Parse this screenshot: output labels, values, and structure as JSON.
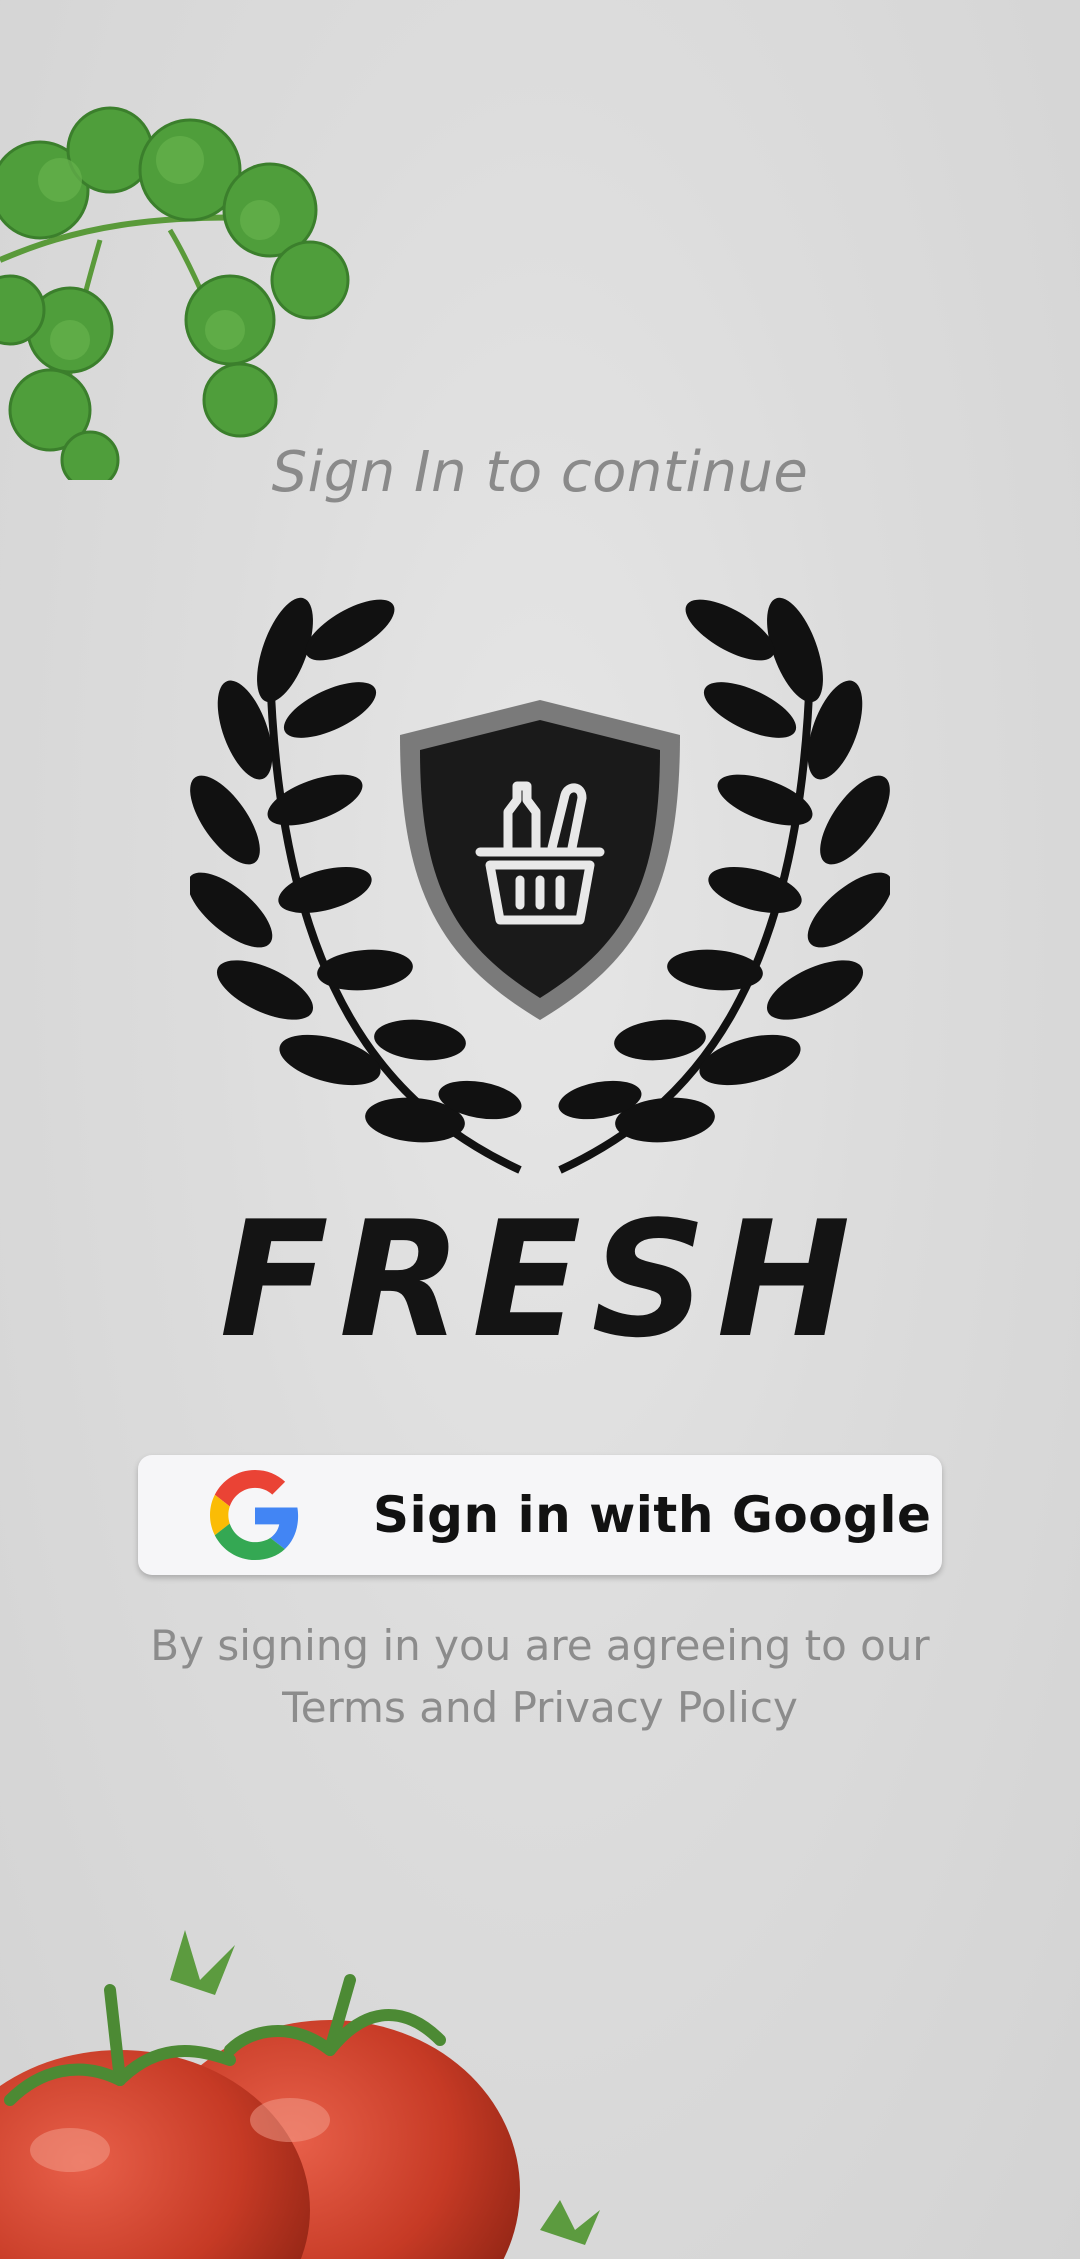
{
  "signin": {
    "title": "Sign In to continue"
  },
  "brand": {
    "name": "FRESH",
    "logo_icon": "shopping-basket-shield-laurel"
  },
  "google_button": {
    "label": "Sign in with Google",
    "icon": "google-g-icon"
  },
  "terms": {
    "line1": "By signing in you are agreeing to our",
    "line2": "Terms and Privacy Policy"
  },
  "decorations": {
    "top_left": "cilantro-herb",
    "bottom_left": "tomatoes"
  },
  "colors": {
    "background": "#dcdcdc",
    "title_text": "#8a8a8a",
    "button_bg": "#f6f6f8",
    "google_blue": "#4285F4",
    "google_red": "#EA4335",
    "google_yellow": "#FBBC05",
    "google_green": "#34A853",
    "herb_green": "#4a9a3a",
    "tomato_red": "#c0392b"
  }
}
